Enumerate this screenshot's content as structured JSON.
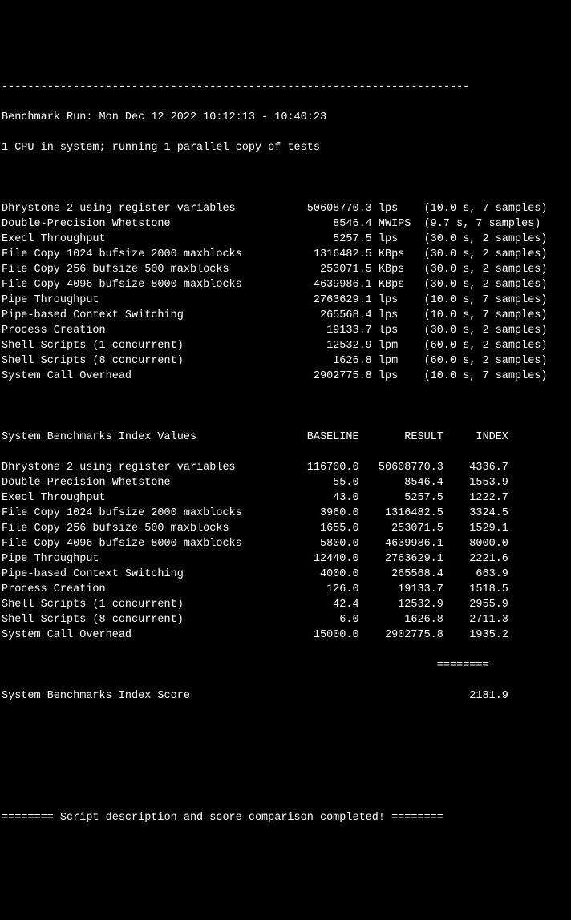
{
  "divider": "------------------------------------------------------------------------",
  "run_header": "Benchmark Run: Mon Dec 12 2022 10:12:13 - 10:40:23",
  "cpu_info": "1 CPU in system; running 1 parallel copy of tests",
  "raw_results": [
    {
      "name": "Dhrystone 2 using register variables",
      "value": "50608770.3",
      "unit": "lps",
      "time": "10.0",
      "samples": "7"
    },
    {
      "name": "Double-Precision Whetstone",
      "value": "8546.4",
      "unit": "MWIPS",
      "time": "9.7",
      "samples": "7"
    },
    {
      "name": "Execl Throughput",
      "value": "5257.5",
      "unit": "lps",
      "time": "30.0",
      "samples": "2"
    },
    {
      "name": "File Copy 1024 bufsize 2000 maxblocks",
      "value": "1316482.5",
      "unit": "KBps",
      "time": "30.0",
      "samples": "2"
    },
    {
      "name": "File Copy 256 bufsize 500 maxblocks",
      "value": "253071.5",
      "unit": "KBps",
      "time": "30.0",
      "samples": "2"
    },
    {
      "name": "File Copy 4096 bufsize 8000 maxblocks",
      "value": "4639986.1",
      "unit": "KBps",
      "time": "30.0",
      "samples": "2"
    },
    {
      "name": "Pipe Throughput",
      "value": "2763629.1",
      "unit": "lps",
      "time": "10.0",
      "samples": "7"
    },
    {
      "name": "Pipe-based Context Switching",
      "value": "265568.4",
      "unit": "lps",
      "time": "10.0",
      "samples": "7"
    },
    {
      "name": "Process Creation",
      "value": "19133.7",
      "unit": "lps",
      "time": "30.0",
      "samples": "2"
    },
    {
      "name": "Shell Scripts (1 concurrent)",
      "value": "12532.9",
      "unit": "lpm",
      "time": "60.0",
      "samples": "2"
    },
    {
      "name": "Shell Scripts (8 concurrent)",
      "value": "1626.8",
      "unit": "lpm",
      "time": "60.0",
      "samples": "2"
    },
    {
      "name": "System Call Overhead",
      "value": "2902775.8",
      "unit": "lps",
      "time": "10.0",
      "samples": "7"
    }
  ],
  "index_header": {
    "label": "System Benchmarks Index Values",
    "baseline": "BASELINE",
    "result": "RESULT",
    "index": "INDEX"
  },
  "index_results": [
    {
      "name": "Dhrystone 2 using register variables",
      "baseline": "116700.0",
      "result": "50608770.3",
      "index": "4336.7"
    },
    {
      "name": "Double-Precision Whetstone",
      "baseline": "55.0",
      "result": "8546.4",
      "index": "1553.9"
    },
    {
      "name": "Execl Throughput",
      "baseline": "43.0",
      "result": "5257.5",
      "index": "1222.7"
    },
    {
      "name": "File Copy 1024 bufsize 2000 maxblocks",
      "baseline": "3960.0",
      "result": "1316482.5",
      "index": "3324.5"
    },
    {
      "name": "File Copy 256 bufsize 500 maxblocks",
      "baseline": "1655.0",
      "result": "253071.5",
      "index": "1529.1"
    },
    {
      "name": "File Copy 4096 bufsize 8000 maxblocks",
      "baseline": "5800.0",
      "result": "4639986.1",
      "index": "8000.0"
    },
    {
      "name": "Pipe Throughput",
      "baseline": "12440.0",
      "result": "2763629.1",
      "index": "2221.6"
    },
    {
      "name": "Pipe-based Context Switching",
      "baseline": "4000.0",
      "result": "265568.4",
      "index": "663.9"
    },
    {
      "name": "Process Creation",
      "baseline": "126.0",
      "result": "19133.7",
      "index": "1518.5"
    },
    {
      "name": "Shell Scripts (1 concurrent)",
      "baseline": "42.4",
      "result": "12532.9",
      "index": "2955.9"
    },
    {
      "name": "Shell Scripts (8 concurrent)",
      "baseline": "6.0",
      "result": "1626.8",
      "index": "2711.3"
    },
    {
      "name": "System Call Overhead",
      "baseline": "15000.0",
      "result": "2902775.8",
      "index": "1935.2"
    }
  ],
  "index_divider": "                                                                   ========",
  "score": {
    "label": "System Benchmarks Index Score",
    "value": "2181.9"
  },
  "footer": "======== Script description and score comparison completed! ========"
}
